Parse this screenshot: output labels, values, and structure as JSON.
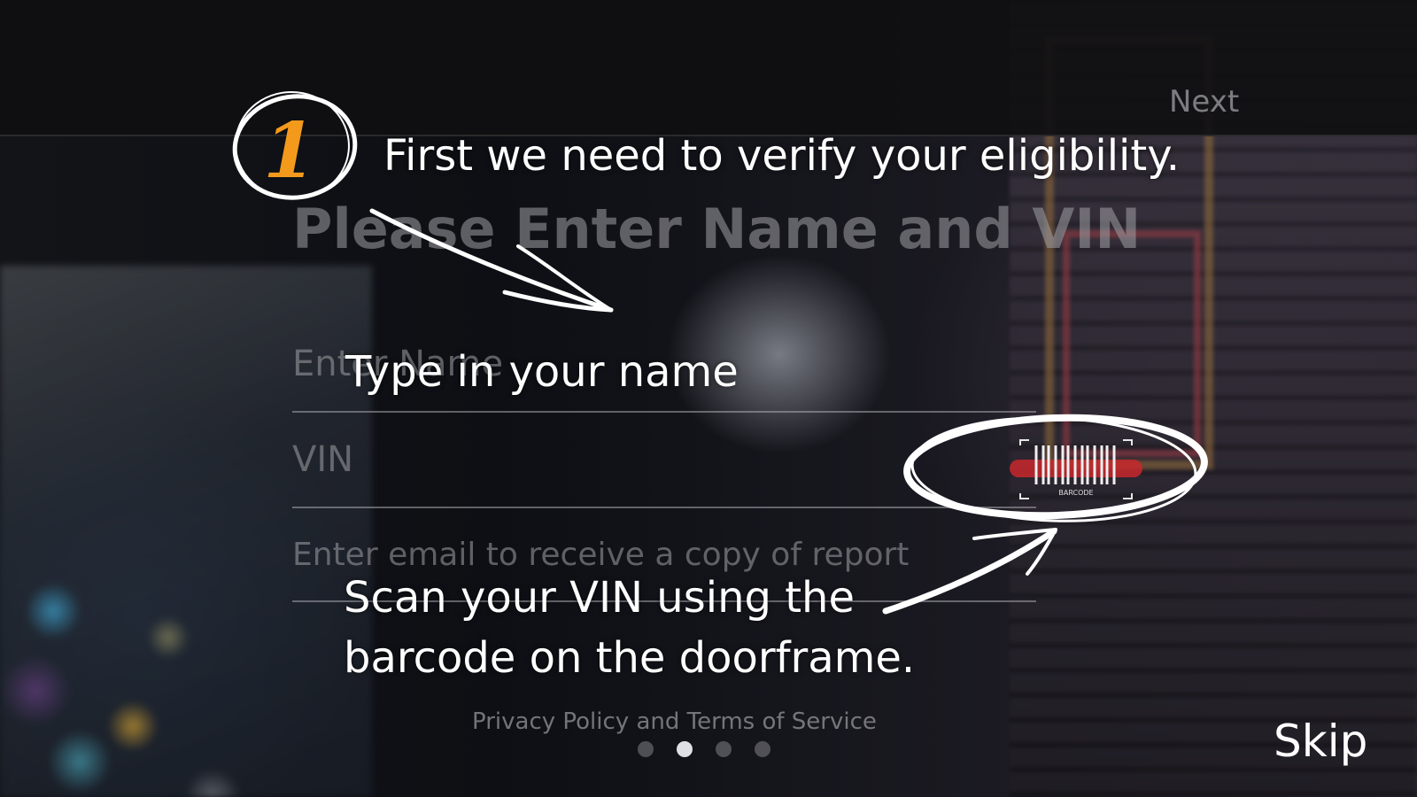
{
  "header": {
    "next_label": "Next"
  },
  "form": {
    "title": "Please Enter Name and VIN",
    "name_placeholder": "Enter Name",
    "vin_placeholder": "VIN",
    "email_placeholder": "Enter email to receive a copy of report",
    "barcode_icon_label": "BARCODE"
  },
  "footer": {
    "privacy_label": "Privacy Policy and Terms of Service",
    "page_dots": 4,
    "active_page": 2,
    "skip_label": "Skip"
  },
  "annotations": {
    "step_number": "1",
    "step_text": "First we need to verify your eligibility.",
    "name_hint": "Type in your name",
    "vin_hint_line1": "Scan your VIN using the",
    "vin_hint_line2": "barcode on the doorframe."
  },
  "colors": {
    "accent_orange": "#f39a1c",
    "barcode_red": "#c8282d",
    "annotation_white": "#ffffff"
  }
}
